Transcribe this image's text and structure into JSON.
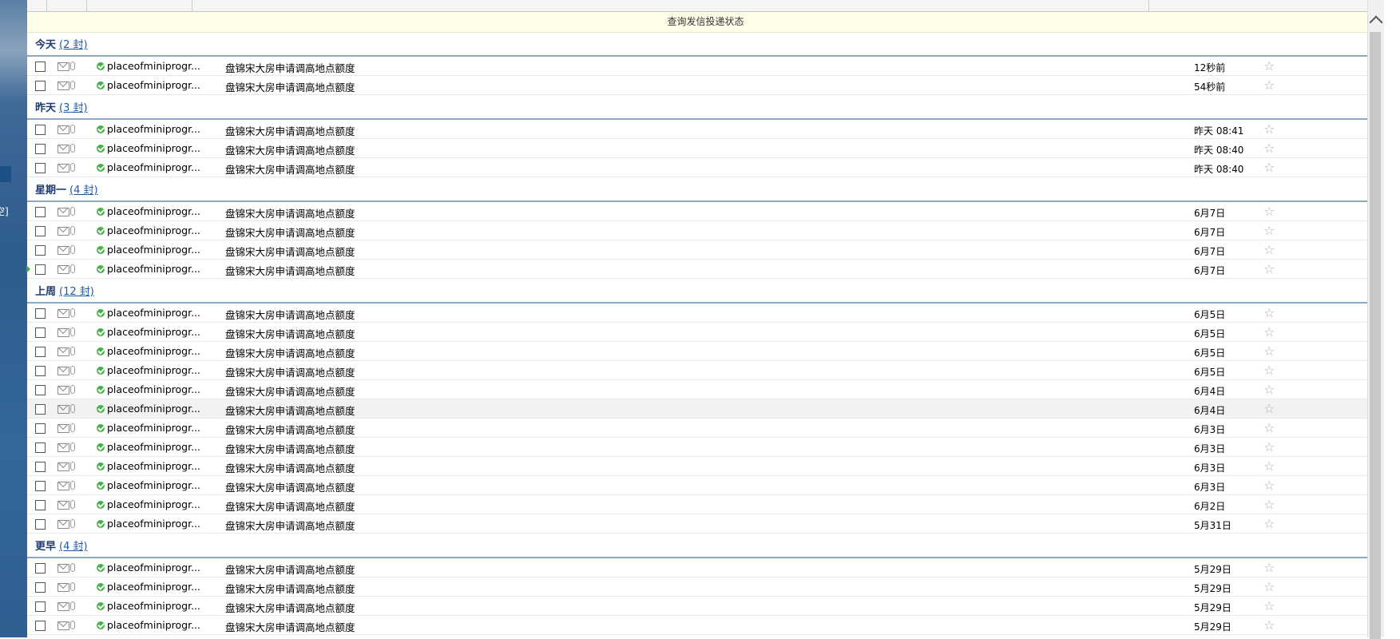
{
  "sidebar": {
    "partial_text": "空]"
  },
  "notice": {
    "text": "查询发信投递状态"
  },
  "groups": [
    {
      "label": "今天",
      "count": "(2 封)",
      "rows": [
        {
          "sender": "placeofminiprogr...",
          "subject": "盘锦宋大房申请调高地点额度",
          "date": "12秒前"
        },
        {
          "sender": "placeofminiprogr...",
          "subject": "盘锦宋大房申请调高地点额度",
          "date": "54秒前"
        }
      ]
    },
    {
      "label": "昨天",
      "count": "(3 封)",
      "rows": [
        {
          "sender": "placeofminiprogr...",
          "subject": "盘锦宋大房申请调高地点额度",
          "date": "昨天 08:41"
        },
        {
          "sender": "placeofminiprogr...",
          "subject": "盘锦宋大房申请调高地点额度",
          "date": "昨天 08:40"
        },
        {
          "sender": "placeofminiprogr...",
          "subject": "盘锦宋大房申请调高地点额度",
          "date": "昨天 08:40"
        }
      ]
    },
    {
      "label": "星期一",
      "count": "(4 封)",
      "rows": [
        {
          "sender": "placeofminiprogr...",
          "subject": "盘锦宋大房申请调高地点额度",
          "date": "6月7日"
        },
        {
          "sender": "placeofminiprogr...",
          "subject": "盘锦宋大房申请调高地点额度",
          "date": "6月7日"
        },
        {
          "sender": "placeofminiprogr...",
          "subject": "盘锦宋大房申请调高地点额度",
          "date": "6月7日"
        },
        {
          "sender": "placeofminiprogr...",
          "subject": "盘锦宋大房申请调高地点额度",
          "date": "6月7日",
          "current": true
        }
      ]
    },
    {
      "label": "上周",
      "count": "(12 封)",
      "rows": [
        {
          "sender": "placeofminiprogr...",
          "subject": "盘锦宋大房申请调高地点额度",
          "date": "6月5日"
        },
        {
          "sender": "placeofminiprogr...",
          "subject": "盘锦宋大房申请调高地点额度",
          "date": "6月5日"
        },
        {
          "sender": "placeofminiprogr...",
          "subject": "盘锦宋大房申请调高地点额度",
          "date": "6月5日"
        },
        {
          "sender": "placeofminiprogr...",
          "subject": "盘锦宋大房申请调高地点额度",
          "date": "6月5日"
        },
        {
          "sender": "placeofminiprogr...",
          "subject": "盘锦宋大房申请调高地点额度",
          "date": "6月4日"
        },
        {
          "sender": "placeofminiprogr...",
          "subject": "盘锦宋大房申请调高地点额度",
          "date": "6月4日",
          "highlighted": true
        },
        {
          "sender": "placeofminiprogr...",
          "subject": "盘锦宋大房申请调高地点额度",
          "date": "6月3日"
        },
        {
          "sender": "placeofminiprogr...",
          "subject": "盘锦宋大房申请调高地点额度",
          "date": "6月3日"
        },
        {
          "sender": "placeofminiprogr...",
          "subject": "盘锦宋大房申请调高地点额度",
          "date": "6月3日"
        },
        {
          "sender": "placeofminiprogr...",
          "subject": "盘锦宋大房申请调高地点额度",
          "date": "6月3日"
        },
        {
          "sender": "placeofminiprogr...",
          "subject": "盘锦宋大房申请调高地点额度",
          "date": "6月2日"
        },
        {
          "sender": "placeofminiprogr...",
          "subject": "盘锦宋大房申请调高地点额度",
          "date": "5月31日"
        }
      ]
    },
    {
      "label": "更早",
      "count": "(4 封)",
      "rows": [
        {
          "sender": "placeofminiprogr...",
          "subject": "盘锦宋大房申请调高地点额度",
          "date": "5月29日"
        },
        {
          "sender": "placeofminiprogr...",
          "subject": "盘锦宋大房申请调高地点额度",
          "date": "5月29日"
        },
        {
          "sender": "placeofminiprogr...",
          "subject": "盘锦宋大房申请调高地点额度",
          "date": "5月29日"
        },
        {
          "sender": "placeofminiprogr...",
          "subject": "盘锦宋大房申请调高地点额度",
          "date": "5月29日"
        }
      ]
    }
  ],
  "icons": {
    "star": "star-outline-icon",
    "verified": "verified-check-icon",
    "envelope": "envelope-icon",
    "attachment": "paperclip-icon"
  },
  "colors": {
    "group_header_text": "#1e3a6e",
    "group_divider": "#8ea6c8",
    "notice_bg": "#fffde8",
    "verified_green": "#47b14a",
    "link_blue": "#1e5aa8"
  }
}
